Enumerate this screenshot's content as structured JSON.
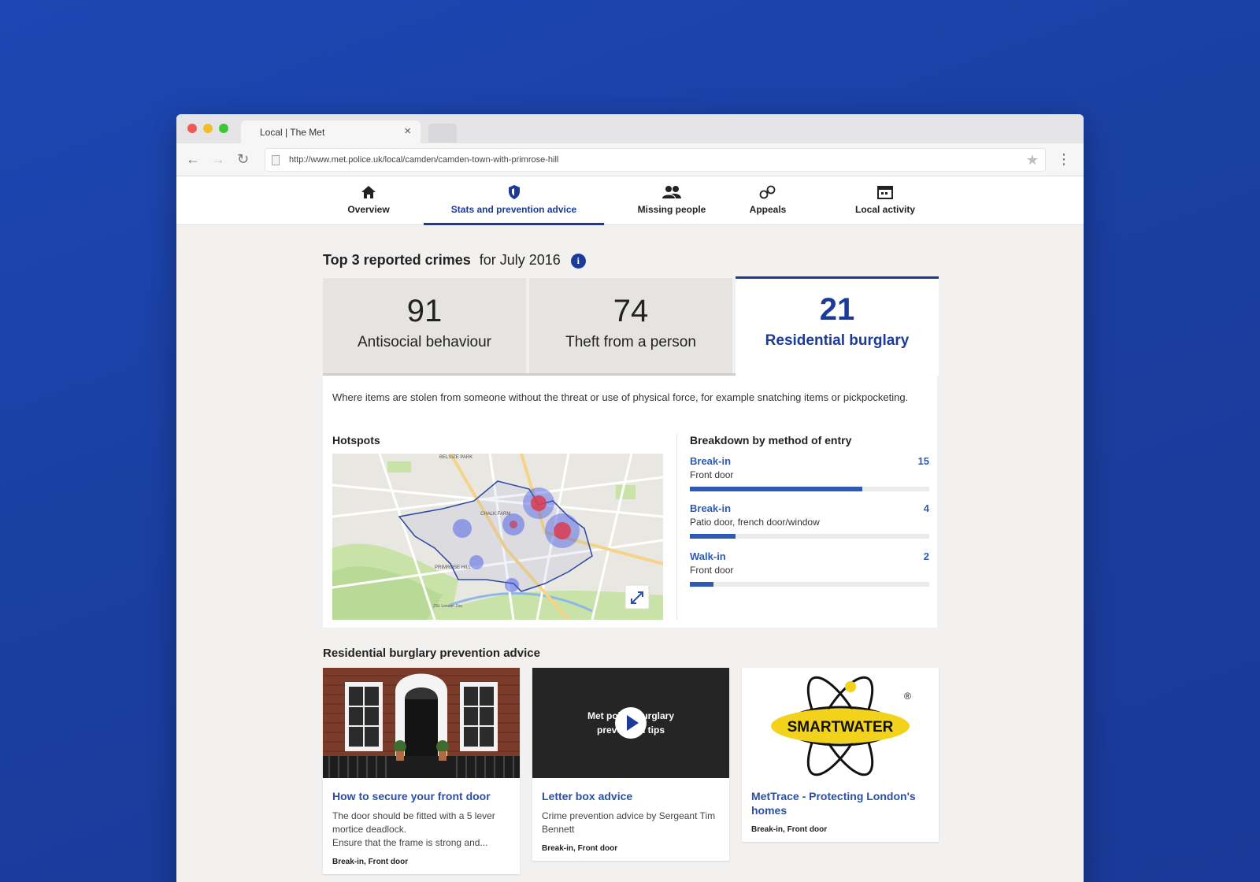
{
  "browser": {
    "tab_title": "Local | The Met",
    "tab_close": "×",
    "url": "http://www.met.police.uk/local/camden/camden-town-with-primrose-hill",
    "back": "←",
    "forward": "→",
    "reload": "↻",
    "star": "★",
    "menu": "⋮"
  },
  "nav": {
    "items": [
      {
        "label": "Overview",
        "icon": "home-icon"
      },
      {
        "label": "Stats and prevention advice",
        "icon": "shield-icon"
      },
      {
        "label": "Missing people",
        "icon": "people-icon"
      },
      {
        "label": "Appeals",
        "icon": "handcuffs-icon"
      },
      {
        "label": "Local activity",
        "icon": "calendar-icon"
      }
    ],
    "active_index": 1
  },
  "crimes": {
    "heading_bold": "Top 3 reported crimes",
    "heading_rest": "for July 2016",
    "info_icon": "i",
    "cards": [
      {
        "value": "91",
        "label": "Antisocial behaviour"
      },
      {
        "value": "74",
        "label": "Theft from a person"
      },
      {
        "value": "21",
        "label": "Residential burglary"
      }
    ],
    "active_index": 2,
    "description": "Where items are stolen from someone without the threat or use of physical force, for example snatching items or pickpocketing.",
    "hotspots_title": "Hotspots",
    "map": {
      "labels": [
        "BELSIZE PARK",
        "CHALK FARM",
        "PRIMROSE HILL",
        "ZSL London Zoo"
      ]
    },
    "breakdown_title": "Breakdown by method of entry",
    "breakdown": [
      {
        "method": "Break-in",
        "detail": "Front door",
        "count": "15",
        "fraction": 0.72
      },
      {
        "method": "Break-in",
        "detail": "Patio door, french door/window",
        "count": "4",
        "fraction": 0.19
      },
      {
        "method": "Walk-in",
        "detail": "Front door",
        "count": "2",
        "fraction": 0.1
      }
    ]
  },
  "advice": {
    "title": "Residential burglary prevention advice",
    "cards": [
      {
        "title": "How to secure your front door",
        "text_1": "The door should be fitted with a 5 lever mortice deadlock.",
        "text_2": "Ensure that the frame is strong and...",
        "tag": "Break-in, Front door"
      },
      {
        "video_caption_1": "Met police burglary",
        "video_caption_2": "prevention tips",
        "title": "Letter box advice",
        "text_1": "Crime prevention advice by Sergeant Tim Bennett",
        "tag": "Break-in, Front door"
      },
      {
        "logo_text": "SMARTWATER",
        "logo_mark": "®",
        "title": "MetTrace - Protecting London's homes",
        "tag": "Break-in, Front door"
      }
    ]
  },
  "colors": {
    "accent": "#1c3a9a",
    "link": "#2b5bb5",
    "background": "#1d47b3"
  }
}
